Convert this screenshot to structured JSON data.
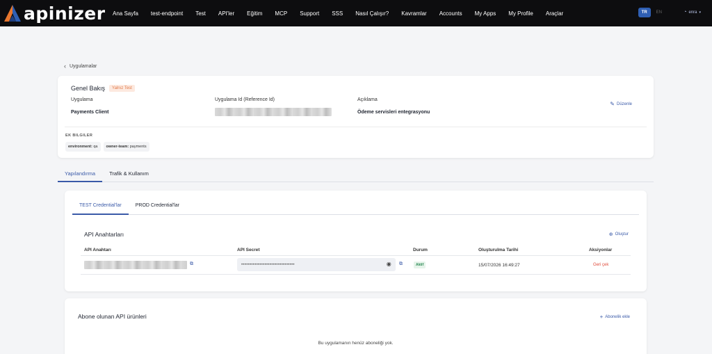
{
  "brand": {
    "name": "apinizer",
    "accent": "#2f5fb3",
    "logo_orange": "#e8772e"
  },
  "nav": [
    "Ana Sayfa",
    "test-endpoint",
    "Test",
    "API'ler",
    "Eğitim",
    "MCP",
    "Support",
    "SSS",
    "Nasıl Çalışır?",
    "Kavramlar",
    "Accounts",
    "My Apps",
    "My Profile",
    "Araçlar"
  ],
  "lang": {
    "active": "TR",
    "other": "EN"
  },
  "user": {
    "name": "enra",
    "icon": "user-icon"
  },
  "back_label": "Uygulamalar",
  "overview": {
    "title": "Genel Bakış",
    "badge": "Yalnız Test",
    "labels": {
      "app": "Uygulama",
      "ref_id": "Uygulama Id (Reference Id)",
      "desc": "Açıklama"
    },
    "values": {
      "app": "Payments Client",
      "desc": "Ödeme servisleri entegrasyonu"
    },
    "edit_label": "Düzenle",
    "extra_title": "EK BILGILER",
    "tags": [
      {
        "key": "environment:",
        "value": "qa"
      },
      {
        "key": "owner-team:",
        "value": "payments"
      }
    ]
  },
  "main_tabs": [
    "Yapılandırma",
    "Trafik & Kullanım"
  ],
  "cred_tabs": [
    "TEST Credential'lar",
    "PROD Credential'lar"
  ],
  "api_keys": {
    "title": "API Anahtarları",
    "create_label": "Oluştur",
    "headers": {
      "key": "API Anahtarı",
      "secret": "API Secret",
      "status": "Durum",
      "created": "Oluşturulma Tarihi",
      "actions": "Aksiyonlar"
    },
    "row": {
      "secret_mask": "••••••••••••••••••••••••••••••••",
      "status": "Aktif",
      "created": "15/07/2026 16:49:27",
      "action": "Geri çek"
    }
  },
  "subscriptions": {
    "title": "Abone olunan API ürünleri",
    "add_label": "Abonelik ekle",
    "empty": "Bu uygulamanın henüz aboneliği yok."
  }
}
